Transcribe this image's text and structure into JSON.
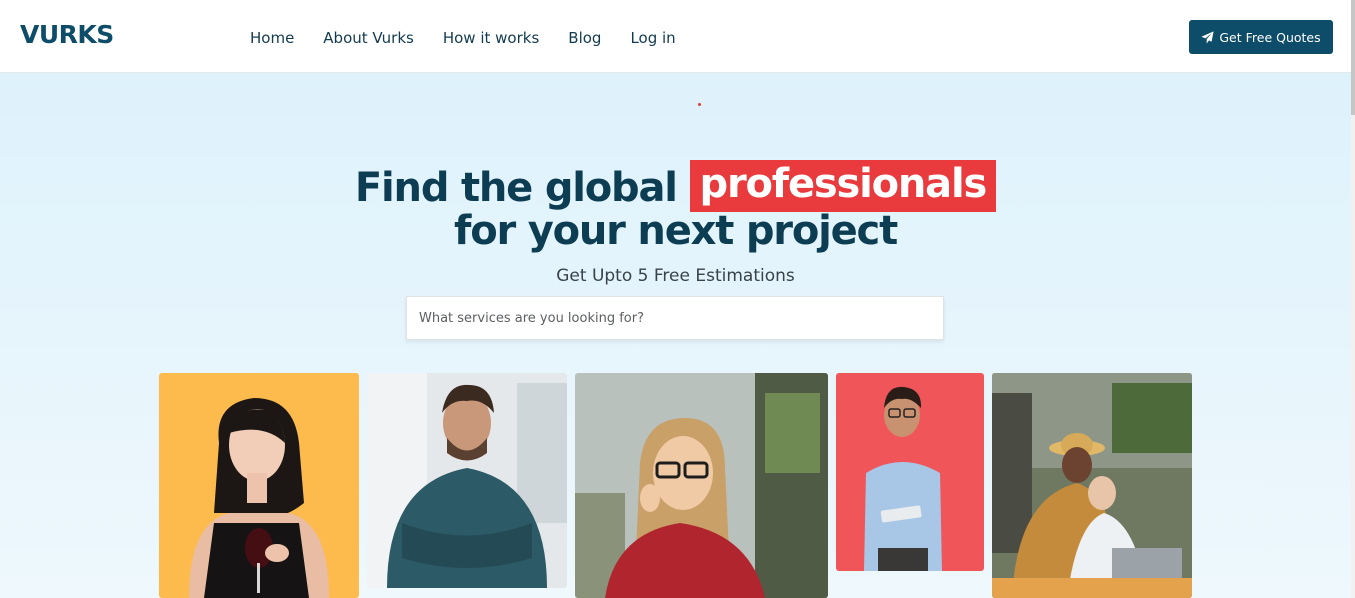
{
  "brand": {
    "logo_text": "VURKS",
    "primary_color": "#0e4d6a",
    "accent_color": "#e93a3e"
  },
  "nav": {
    "items": [
      "Home",
      "About Vurks",
      "How it works",
      "Blog",
      "Log in"
    ]
  },
  "cta": {
    "label": "Get Free Quotes",
    "icon": "paper-plane-icon"
  },
  "hero": {
    "title_before": "Find the global ",
    "title_highlight": "professionals",
    "title_line2": "for your next project",
    "subtitle": "Get Upto 5 Free Estimations"
  },
  "search": {
    "placeholder": "What services are you looking for?",
    "value": ""
  },
  "gallery": {
    "cards": [
      {
        "desc": "woman-with-wine-glass",
        "bg": "#fdbb4d"
      },
      {
        "desc": "man-arms-crossed",
        "bg": "#cfd6da"
      },
      {
        "desc": "woman-with-glasses-office",
        "bg": "#8f9a8a"
      },
      {
        "desc": "man-with-tablet",
        "bg": "#f0555a"
      },
      {
        "desc": "two-men-at-laptop",
        "bg": "#6f7860"
      }
    ]
  }
}
